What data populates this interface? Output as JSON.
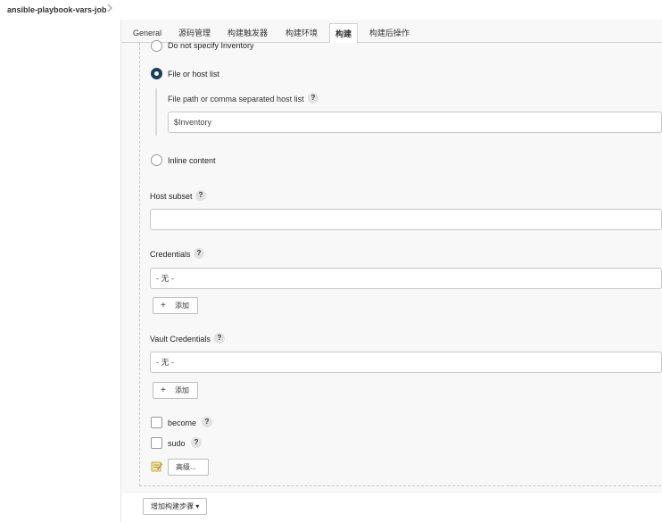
{
  "breadcrumb": {
    "job_name": "ansible-playbook-vars-job"
  },
  "tabs": [
    {
      "label": "General"
    },
    {
      "label": "源码管理"
    },
    {
      "label": "构建触发器"
    },
    {
      "label": "构建环境"
    },
    {
      "label": "构建",
      "active": true
    },
    {
      "label": "构建后操作"
    }
  ],
  "inventory": {
    "option_no_inventory": "Do not specify Inventory",
    "option_file_or_host": "File or host list",
    "option_inline": "Inline content",
    "selected": "File or host list",
    "file_path_label": "File path or comma separated host list",
    "file_path_value": "$Inventory"
  },
  "host_subset": {
    "label": "Host subset",
    "value": ""
  },
  "credentials": {
    "label": "Credentials",
    "selected": "- 无 -",
    "add_button": "添加"
  },
  "vault_credentials": {
    "label": "Vault Credentials",
    "selected": "- 无 -",
    "add_button": "添加"
  },
  "become": {
    "label": "become",
    "checked": false
  },
  "sudo": {
    "label": "sudo",
    "checked": false
  },
  "advanced_button": "高级...",
  "add_build_step_button": "增加构建步骤 ▾",
  "help_glyph": "?",
  "colors": {
    "radio_selected": "#1c3d5a",
    "panel_bg": "#f8f8f8"
  }
}
